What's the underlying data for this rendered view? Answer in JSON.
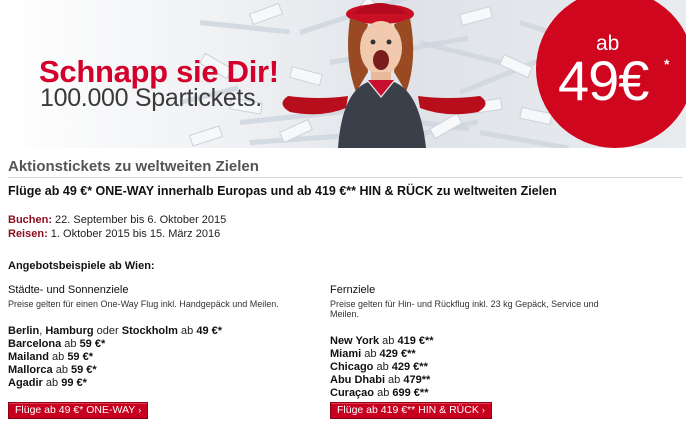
{
  "banner": {
    "headline": "Schnapp sie Dir!",
    "subline": "100.000 Spartickets.",
    "price_prefix": "ab",
    "price_value": "49€",
    "price_star": "*",
    "colors": {
      "brand_red": "#d0051e",
      "text_red": "#d2002a"
    }
  },
  "page": {
    "title": "Aktionstickets zu weltweiten Zielen",
    "subheading": "Flüge ab 49 €* ONE-WAY innerhalb Europas und ab 419 €** HIN & RÜCK zu weltweiten Zielen",
    "booking_label": "Buchen:",
    "booking_value": " 22. September bis 6. Oktober 2015",
    "travel_label": "Reisen:",
    "travel_value": " 1. Oktober 2015 bis 15. März 2016",
    "examples_heading": "Angebotsbeispiele ab Wien:"
  },
  "left": {
    "title": "Städte- und Sonnenziele",
    "note": "Preise gelten für einen One-Way Flug inkl. Handgepäck und Meilen.",
    "offer1": {
      "city1": "Berlin",
      "sep1": ", ",
      "city2": "Hamburg",
      "sep2": " oder ",
      "city3": "Stockholm",
      "ab": " ab ",
      "price": "49 €*"
    },
    "offers": [
      {
        "city": "Barcelona",
        "ab": " ab ",
        "price": "59 €*"
      },
      {
        "city": "Mailand",
        "ab": " ab ",
        "price": "59 €*"
      },
      {
        "city": "Mallorca",
        "ab": " ab ",
        "price": "59 €*"
      },
      {
        "city": "Agadir",
        "ab": " ab ",
        "price": "99 €*"
      }
    ],
    "button_label": "Flüge ab 49 €* ONE-WAY",
    "button_chevron": "›"
  },
  "right": {
    "title": "Fernziele",
    "note": "Preise gelten für Hin- und Rückflug inkl. 23 kg Gepäck, Service und Meilen.",
    "offers": [
      {
        "city": "New York",
        "ab": " ab ",
        "price": "419 €**"
      },
      {
        "city": "Miami",
        "ab": " ab ",
        "price": "429 €**"
      },
      {
        "city": "Chicago",
        "ab": " ab ",
        "price": "429 €**"
      },
      {
        "city": "Abu Dhabi",
        "ab": " ab ",
        "price": "479**"
      },
      {
        "city": "Curaçao",
        "ab": " ab ",
        "price": "699 €**"
      }
    ],
    "button_label": "Flüge ab 419 €** HIN & RÜCK",
    "button_chevron": "›"
  }
}
